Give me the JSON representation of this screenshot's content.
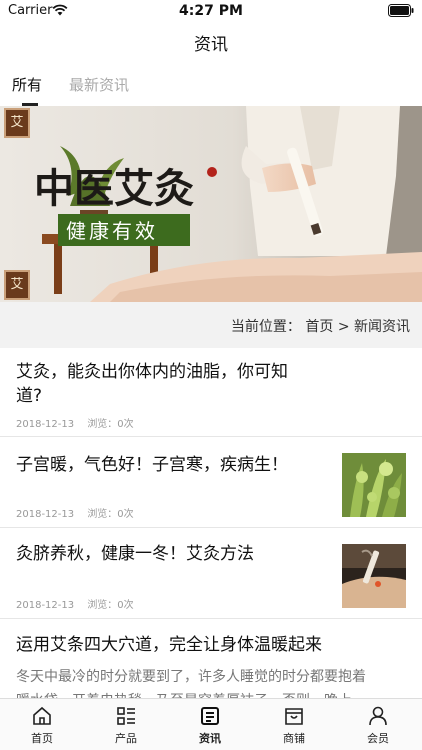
{
  "status_bar": {
    "carrier": "Carrier",
    "time": "4:27 PM"
  },
  "nav": {
    "title": "资讯"
  },
  "tabs": [
    {
      "label": "所有",
      "active": true
    },
    {
      "label": "最新资讯",
      "active": false
    }
  ],
  "banner": {
    "headline": "中医艾灸",
    "slogan": "健康有效",
    "badge_glyph": "艾"
  },
  "breadcrumb": {
    "prefix": "当前位置：",
    "home": "首页",
    "separator": ">",
    "current": "新闻资讯"
  },
  "articles": [
    {
      "title_line1": "艾灸，能灸出你体内的油脂，你可知",
      "title_line2": "道?",
      "date": "2018-12-13",
      "views": "浏览：0次",
      "thumb": "none"
    },
    {
      "title_line1": "子宫暖，气色好！子宫寒，疾病生！",
      "date": "2018-12-13",
      "views": "浏览：0次",
      "thumb": "green-herb"
    },
    {
      "title_line1": "灸脐养秋，健康一冬！艾灸方法",
      "date": "2018-12-13",
      "views": "浏览：0次",
      "thumb": "moxa-therapy"
    },
    {
      "title_line1": "运用艾条四大穴道，完全让身体温暖起来",
      "excerpt_line1": "冬天中最冷的时分就要到了，许多人睡觉的时分都要抱着",
      "excerpt_line2": "暖水袋，开着电热毯，乃至是穿着厚袜子，否则，晚上"
    }
  ],
  "tab_bar": [
    {
      "label": "首页",
      "icon": "home-icon"
    },
    {
      "label": "产品",
      "icon": "product-list-icon"
    },
    {
      "label": "资讯",
      "icon": "news-icon"
    },
    {
      "label": "商铺",
      "icon": "shop-icon"
    },
    {
      "label": "会员",
      "icon": "member-icon"
    }
  ],
  "colors": {
    "accent_dark": "#222222",
    "inactive_tab": "#aaaaaa",
    "banner_green": "#3d6b1e",
    "seal_brown": "#6a3a1c"
  }
}
